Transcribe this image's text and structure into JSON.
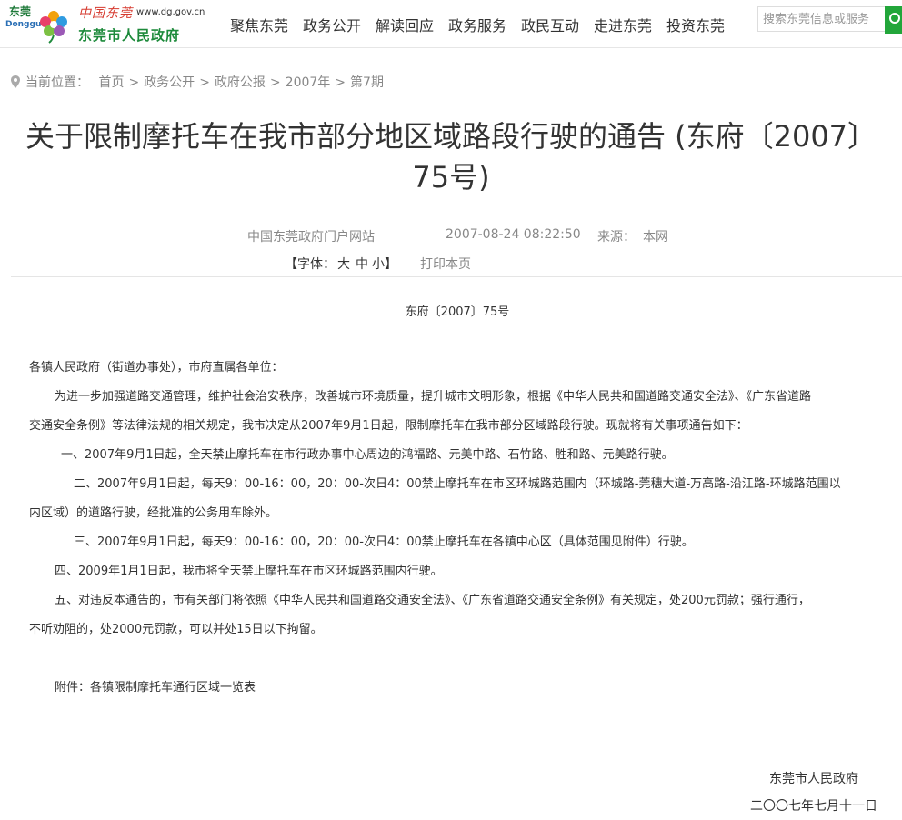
{
  "header": {
    "logo": {
      "dongguan_cn": "东莞",
      "dongguan_en": "Dongguan",
      "china_dongguan": "中国东莞",
      "url": "www.dg.gov.cn",
      "gov_name": "东莞市人民政府"
    },
    "nav": [
      "聚焦东莞",
      "政务公开",
      "解读回应",
      "政务服务",
      "政民互动",
      "走进东莞",
      "投资东莞"
    ],
    "search": {
      "placeholder": "搜索东莞信息或服务"
    }
  },
  "breadcrumb": {
    "prefix": "当前位置：",
    "items": [
      "首页",
      "政务公开",
      "政府公报",
      "2007年",
      "第7期"
    ],
    "separator": ">"
  },
  "article": {
    "title_line1": "关于限制摩托车在我市部分地区域路段行驶的通告 (东府〔2007〕",
    "title_line2": "75号)",
    "source": "中国东莞政府门户网站",
    "date": "2007-08-24 08:22:50",
    "origin_label": "来源：",
    "origin": "本网",
    "font_size_label": "【字体：",
    "font_large": "大",
    "font_medium": "中",
    "font_small": "小",
    "font_close": "】",
    "print": "打印本页",
    "doc_number": "东府〔2007〕75号",
    "salutation": "各镇人民政府（街道办事处），市府直属各单位：",
    "intro_line1": "为进一步加强道路交通管理，维护社会治安秩序，改善城市环境质量，提升城市文明形象，根据《中华人民共和国道路交通安全法》、《广东省道路",
    "intro_line2": "交通安全条例》等法律法规的相关规定，我市决定从2007年9月1日起，限制摩托车在我市部分区域路段行驶。现就将有关事项通告如下：",
    "item1": "一、2007年9月1日起，全天禁止摩托车在市行政办事中心周边的鸿福路、元美中路、石竹路、胜和路、元美路行驶。",
    "item2_line1": "二、2007年9月1日起，每天9：00-16：00，20：00-次日4：00禁止摩托车在市区环城路范围内（环城路-莞穗大道-万高路-沿江路-环城路范围以",
    "item2_line2": "内区域）的道路行驶，经批准的公务用车除外。",
    "item3": "三、2007年9月1日起，每天9：00-16：00，20：00-次日4：00禁止摩托车在各镇中心区（具体范围见附件）行驶。",
    "item4": "四、2009年1月1日起，我市将全天禁止摩托车在市区环城路范围内行驶。",
    "item5_line1": "五、对违反本通告的，市有关部门将依照《中华人民共和国道路交通安全法》、《广东省道路交通安全条例》有关规定，处200元罚款；强行通行，",
    "item5_line2": "不听劝阻的，处2000元罚款，可以并处15日以下拘留。",
    "attachment": "附件：各镇限制摩托车通行区域一览表",
    "signature_org": "东莞市人民政府",
    "signature_date": "二〇〇七年七月十一日"
  },
  "colors": {
    "brand_green": "#22a63a",
    "gov_name_green": "#1d8a3b",
    "china_red": "#d63a2f",
    "text": "#333333",
    "muted": "#888888"
  }
}
